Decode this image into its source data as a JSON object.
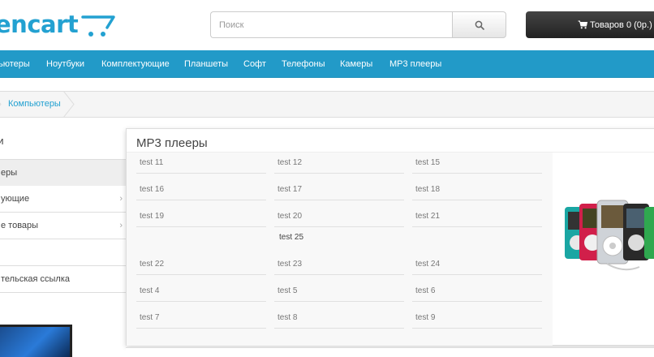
{
  "header": {
    "logo_text": "encart",
    "search_placeholder": "Поиск",
    "cart_label": "Товаров 0 (0р.)",
    "search_icon": "search-icon",
    "cart_icon": "shopping-cart-icon"
  },
  "menu": {
    "items": [
      "ьютеры",
      "Ноутбуки",
      "Комплектующие",
      "Планшеты",
      "Софт",
      "Телефоны",
      "Камеры",
      "MP3 плееры"
    ]
  },
  "breadcrumb": {
    "link": "Компьютеры"
  },
  "sidebar": {
    "heading": "ии",
    "items": [
      {
        "label": "еры",
        "chevron": false
      },
      {
        "label": "ующие",
        "chevron": true
      },
      {
        "label": "е товары",
        "chevron": true
      },
      {
        "label": "",
        "chevron": false
      },
      {
        "label": "тельская ссылка",
        "chevron": false
      }
    ]
  },
  "dropdown": {
    "title": "MP3 плееры",
    "items": [
      "test 11",
      "test 12",
      "test 15",
      "test 16",
      "test 17",
      "test 18",
      "test 19",
      "test 20",
      "test 21",
      "test 25",
      "test 22",
      "test 23",
      "test 24",
      "test 4",
      "test 5",
      "test 6",
      "test 7",
      "test 8",
      "test 9"
    ]
  },
  "colors": {
    "accent": "#229ac8",
    "logo": "#23a1d1",
    "cart_button": "#222222"
  }
}
